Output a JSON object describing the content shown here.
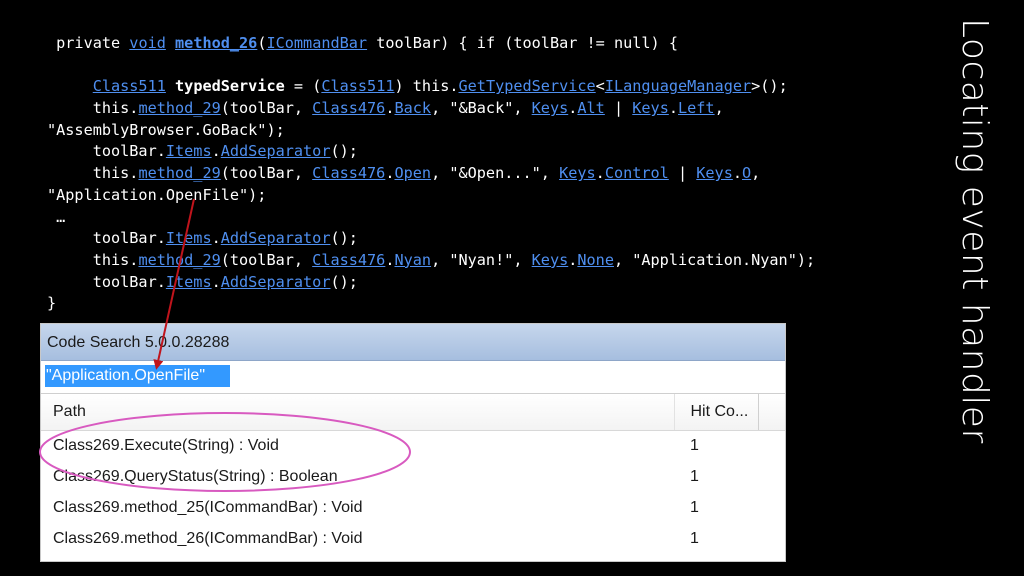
{
  "slide": {
    "title": "Locating event handler"
  },
  "code": {
    "lines": [
      [
        {
          "t": " private ",
          "s": "plain"
        },
        {
          "t": "void",
          "s": "link"
        },
        {
          "t": " ",
          "s": "plain"
        },
        {
          "t": "method_26",
          "s": "boldlink"
        },
        {
          "t": "(",
          "s": "plain"
        },
        {
          "t": "ICommandBar",
          "s": "link"
        },
        {
          "t": " toolBar) { if (toolBar != null) {",
          "s": "plain"
        }
      ],
      [
        {
          "t": " ",
          "s": "plain"
        }
      ],
      [
        {
          "t": "     ",
          "s": "plain"
        },
        {
          "t": "Class511",
          "s": "link"
        },
        {
          "t": " ",
          "s": "plain"
        },
        {
          "t": "typedService",
          "s": "bold"
        },
        {
          "t": " = (",
          "s": "plain"
        },
        {
          "t": "Class511",
          "s": "link"
        },
        {
          "t": ") this.",
          "s": "plain"
        },
        {
          "t": "GetTypedService",
          "s": "link"
        },
        {
          "t": "<",
          "s": "plain"
        },
        {
          "t": "ILanguageManager",
          "s": "link"
        },
        {
          "t": ">();",
          "s": "plain"
        }
      ],
      [
        {
          "t": "     this.",
          "s": "plain"
        },
        {
          "t": "method_29",
          "s": "link"
        },
        {
          "t": "(toolBar, ",
          "s": "plain"
        },
        {
          "t": "Class476",
          "s": "link"
        },
        {
          "t": ".",
          "s": "plain"
        },
        {
          "t": "Back",
          "s": "link"
        },
        {
          "t": ", \"&Back\", ",
          "s": "plain"
        },
        {
          "t": "Keys",
          "s": "link"
        },
        {
          "t": ".",
          "s": "plain"
        },
        {
          "t": "Alt",
          "s": "link"
        },
        {
          "t": " | ",
          "s": "plain"
        },
        {
          "t": "Keys",
          "s": "link"
        },
        {
          "t": ".",
          "s": "plain"
        },
        {
          "t": "Left",
          "s": "link"
        },
        {
          "t": ",",
          "s": "plain"
        }
      ],
      [
        {
          "t": "\"AssemblyBrowser.GoBack\");",
          "s": "plain"
        }
      ],
      [
        {
          "t": "     toolBar.",
          "s": "plain"
        },
        {
          "t": "Items",
          "s": "link"
        },
        {
          "t": ".",
          "s": "plain"
        },
        {
          "t": "AddSeparator",
          "s": "link"
        },
        {
          "t": "();",
          "s": "plain"
        }
      ],
      [
        {
          "t": "     this.",
          "s": "plain"
        },
        {
          "t": "method_29",
          "s": "link"
        },
        {
          "t": "(toolBar, ",
          "s": "plain"
        },
        {
          "t": "Class476",
          "s": "link"
        },
        {
          "t": ".",
          "s": "plain"
        },
        {
          "t": "Open",
          "s": "link"
        },
        {
          "t": ", \"&Open...\", ",
          "s": "plain"
        },
        {
          "t": "Keys",
          "s": "link"
        },
        {
          "t": ".",
          "s": "plain"
        },
        {
          "t": "Control",
          "s": "link"
        },
        {
          "t": " | ",
          "s": "plain"
        },
        {
          "t": "Keys",
          "s": "link"
        },
        {
          "t": ".",
          "s": "plain"
        },
        {
          "t": "O",
          "s": "link"
        },
        {
          "t": ",",
          "s": "plain"
        }
      ],
      [
        {
          "t": "\"Application.OpenFile\");",
          "s": "plain"
        }
      ],
      [
        {
          "t": " …",
          "s": "plain"
        }
      ],
      [
        {
          "t": "     toolBar.",
          "s": "plain"
        },
        {
          "t": "Items",
          "s": "link"
        },
        {
          "t": ".",
          "s": "plain"
        },
        {
          "t": "AddSeparator",
          "s": "link"
        },
        {
          "t": "();",
          "s": "plain"
        }
      ],
      [
        {
          "t": "     this.",
          "s": "plain"
        },
        {
          "t": "method_29",
          "s": "link"
        },
        {
          "t": "(toolBar, ",
          "s": "plain"
        },
        {
          "t": "Class476",
          "s": "link"
        },
        {
          "t": ".",
          "s": "plain"
        },
        {
          "t": "Nyan",
          "s": "link"
        },
        {
          "t": ", \"Nyan!\", ",
          "s": "plain"
        },
        {
          "t": "Keys",
          "s": "link"
        },
        {
          "t": ".",
          "s": "plain"
        },
        {
          "t": "None",
          "s": "link"
        },
        {
          "t": ", \"Application.Nyan\");",
          "s": "plain"
        }
      ],
      [
        {
          "t": "     toolBar.",
          "s": "plain"
        },
        {
          "t": "Items",
          "s": "link"
        },
        {
          "t": ".",
          "s": "plain"
        },
        {
          "t": "AddSeparator",
          "s": "link"
        },
        {
          "t": "();",
          "s": "plain"
        }
      ],
      [
        {
          "t": "}",
          "s": "plain"
        }
      ]
    ]
  },
  "code_search": {
    "window_title": "Code Search 5.0.0.28288",
    "search_value": "\"Application.OpenFile\"",
    "columns": {
      "path": "Path",
      "hits": "Hit Co..."
    },
    "rows": [
      {
        "path": "Class269.Execute(String) : Void",
        "hits": "1"
      },
      {
        "path": "Class269.QueryStatus(String) : Boolean",
        "hits": "1"
      },
      {
        "path": "Class269.method_25(ICommandBar) : Void",
        "hits": "1"
      },
      {
        "path": "Class269.method_26(ICommandBar) : Void",
        "hits": "1"
      }
    ]
  },
  "annotations": {
    "arrow_color": "#c0141c",
    "ellipse_color": "#d85ac0"
  }
}
